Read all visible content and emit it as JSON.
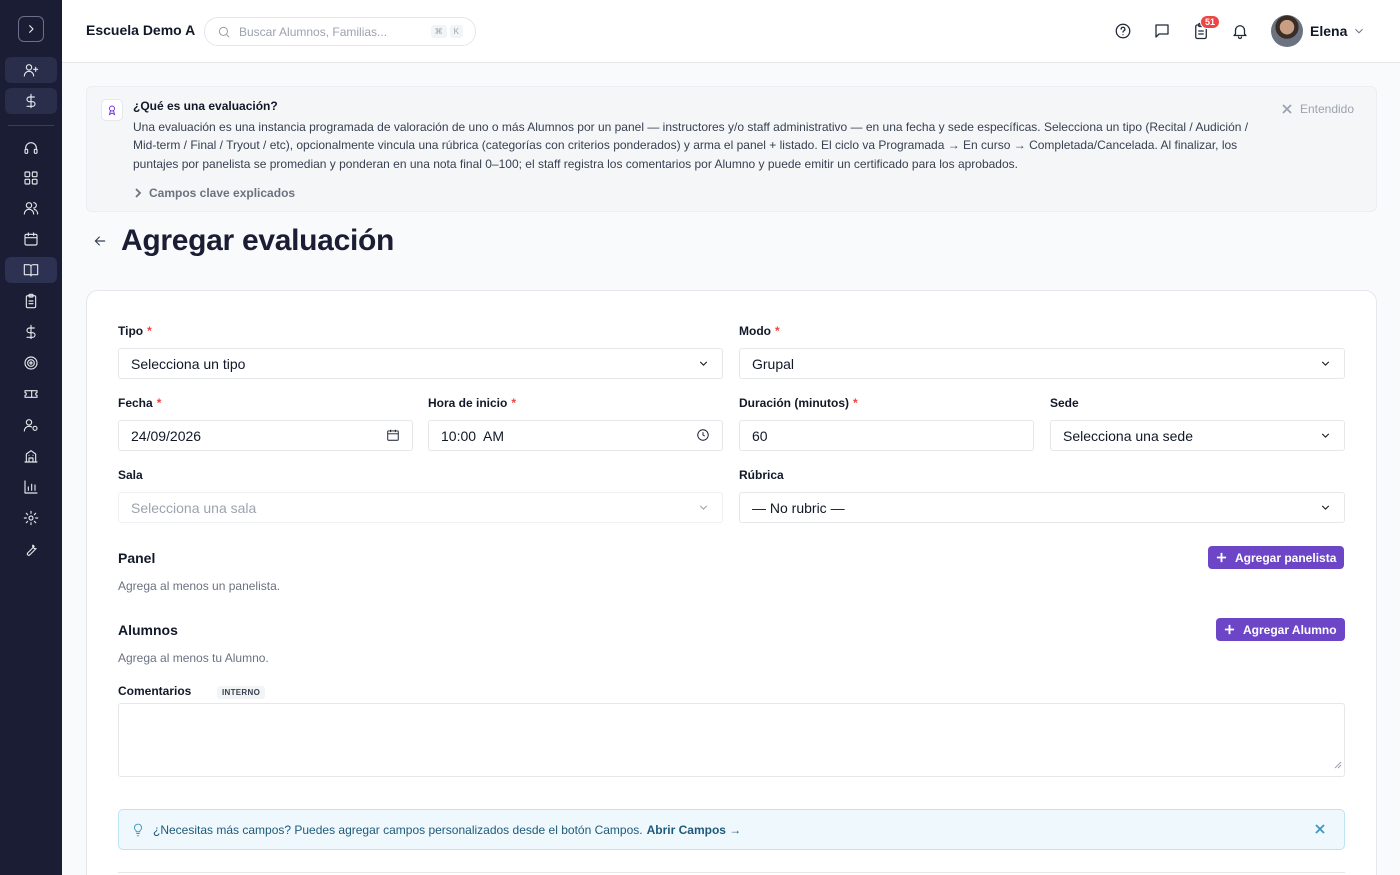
{
  "header": {
    "school_name": "Escuela Demo A",
    "search_placeholder": "Buscar Alumnos, Familias...",
    "search_shortcut_key1": "⌘",
    "search_shortcut_key2": "K",
    "tasks_badge": "51",
    "user_name": "Elena"
  },
  "sidebar": {
    "items": [
      "add-user",
      "billing",
      "support",
      "dashboard",
      "people",
      "calendar",
      "classes",
      "evaluations",
      "payments",
      "goals",
      "tickets",
      "staff",
      "school",
      "reports",
      "settings",
      "tools"
    ]
  },
  "info_banner": {
    "title": "¿Qué es una evaluación?",
    "body": "Una evaluación es una instancia programada de valoración de uno o más Alumnos por un panel — instructores y/o staff administrativo — en una fecha y sede específicas. Selecciona un tipo (Recital / Audición / Mid-term / Final / Tryout / etc), opcionalmente vincula una rúbrica (categorías con criterios ponderados) y arma el panel + listado. El ciclo va Programada → En curso → Completada/Cancelada. Al finalizar, los puntajes por panelista se promedian y ponderan en una nota final 0–100; el staff registra los comentarios por Alumno y puede emitir un certificado para los aprobados.",
    "dismiss_label": "Entendido",
    "more_label": "Campos clave explicados"
  },
  "page": {
    "title": "Agregar evaluación"
  },
  "form": {
    "tipo_label": "Tipo",
    "tipo_value": "Selecciona un tipo",
    "modo_label": "Modo",
    "modo_value": "Grupal",
    "fecha_label": "Fecha",
    "fecha_value": "24/09/2026",
    "hora_label": "Hora de inicio",
    "hora_value": "10:00  AM",
    "duracion_label": "Duración (minutos)",
    "duracion_value": "60",
    "sede_label": "Sede",
    "sede_value": "Selecciona una sede",
    "sala_label": "Sala",
    "sala_value": "Selecciona una sala",
    "rubrica_label": "Rúbrica",
    "rubrica_value": "— No rubric —",
    "required_mark": "*",
    "panel_title": "Panel",
    "panel_hint": "Agrega al menos un panelista.",
    "panel_button": "Agregar panelista",
    "alumnos_title": "Alumnos",
    "alumnos_hint": "Agrega al menos tu Alumno.",
    "alumnos_button": "Agregar Alumno",
    "comentarios_label": "Comentarios",
    "comentarios_tag": "INTERNO",
    "tip_text": "¿Necesitas más campos? Puedes agregar campos personalizados desde el botón Campos.",
    "tip_link": "Abrir Campos →"
  },
  "colors": {
    "sidebar_bg": "#1a1d33",
    "primary": "#6d46c8",
    "required": "#ef4444",
    "tip_bg": "#eff8fc"
  }
}
